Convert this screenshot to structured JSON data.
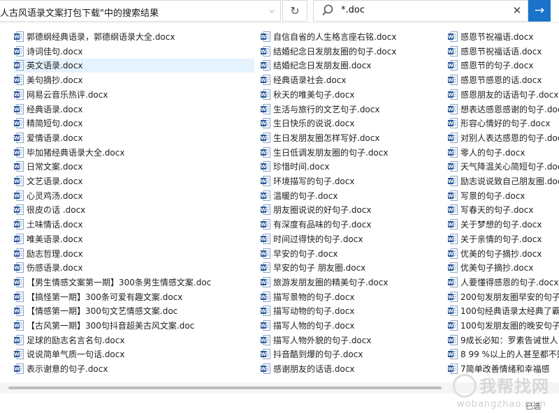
{
  "address_bar": {
    "text": "人古风语录文案打包下载\"中的搜索结果"
  },
  "search": {
    "query": "*.doc"
  },
  "icons": {
    "refresh": "refresh-icon",
    "search": "search-icon",
    "clear": "close-icon",
    "go": "arrow-right-icon",
    "dropdown": "chevron-down-icon",
    "file": "word-document-icon"
  },
  "colors": {
    "accent": "#1a73c9",
    "word_icon": "#2b579a",
    "selection": "#e5f3ff"
  },
  "files": {
    "col1": [
      "郭德纲经典语录，郭德纲语录大全.docx",
      "诗词佳句.docx",
      "英文语录.docx",
      "美句摘抄.docx",
      "网易云音乐热评.docx",
      "经典语录.docx",
      "精简短句.docx",
      "爱情语录.docx",
      "毕加猪经典语录大全.docx",
      "日常文案.docx",
      "文艺语录.docx",
      "心灵鸡汤.docx",
      "很皮の话 .docx",
      "土味情话.docx",
      "唯美语录.docx",
      "励志哲理.docx",
      "伤感语录.docx",
      "【男生情感文案第一期】300条男生情感文案.doc",
      "【搞怪第一期】300条可爱有趣文案.docx",
      "【情感第一期】300句文艺情感文案.doc",
      "【古风第一期】300句抖音超美古风文案.doc",
      "足球的励志名言名句.docx",
      "说说简单气质一句话.docx",
      "表示谢意的句子.docx"
    ],
    "col2": [
      "自信自省的人生格言座右铭.docx",
      "结婚纪念日发朋友圈的句子.docx",
      "结婚纪念日发朋友圈.docx",
      "经典语录社会.docx",
      "秋天的唯美句子.docx",
      "生活与旅行的文艺句子.docx",
      "生日快乐的说说.docx",
      "生日发朋友圈怎样写好.docx",
      "生日低调发朋友圈的句子.docx",
      "珍惜时间.docx",
      "环境描写的句子.docx",
      "温暖的句子.docx",
      "朋友圈说说的好句子.docx",
      "有深度有品味的句子.docx",
      "时间过得快的句子.docx",
      "早安的句子.docx",
      "早安的句子 朋友圈.docx",
      "旅游发朋友圈的精美句子.docx",
      "描写景物的句子.docx",
      "描写动物的句子.docx",
      "描写人物的句子.docx",
      "描写人物外貌的句子.docx",
      "抖音酷到爆的句子.docx",
      "感谢朋友的话语.docx"
    ],
    "col3": [
      "感恩节祝福语.docx",
      "感恩节祝福话语.docx",
      "感恩节的句子.docx",
      "感恩节感恩的话.docx",
      "感恩朋友的话语句子.docx",
      "想表达感恩感谢的句子.docx",
      "形容心情好的句子.docx",
      "对别人表达感恩的句子.docx",
      "零人的句子.docx",
      "天气降温关心简短句子.docx",
      "励志说说致自己朋友圈.docx",
      "写景的句子.docx",
      "写春天的句子.docx",
      "关于梦想的句子.docx",
      "关于亲情的句子.docx",
      "优美的句子摘抄.docx",
      "优美句子摘抄.docx",
      "人要懂得感恩的句子.docx",
      "200句发朋友圈早安的句子",
      "100句经典语录太经典了霸",
      "100句发朋友圈的晚安句子",
      "9成长必知：罗素告诫世人",
      "8 99 %以上的人甚至都不知",
      "7简单改善情绪和幸福感"
    ]
  },
  "watermark": {
    "brand": "我帮找网",
    "url": "wobangzhao.com",
    "fragment": "已选"
  }
}
